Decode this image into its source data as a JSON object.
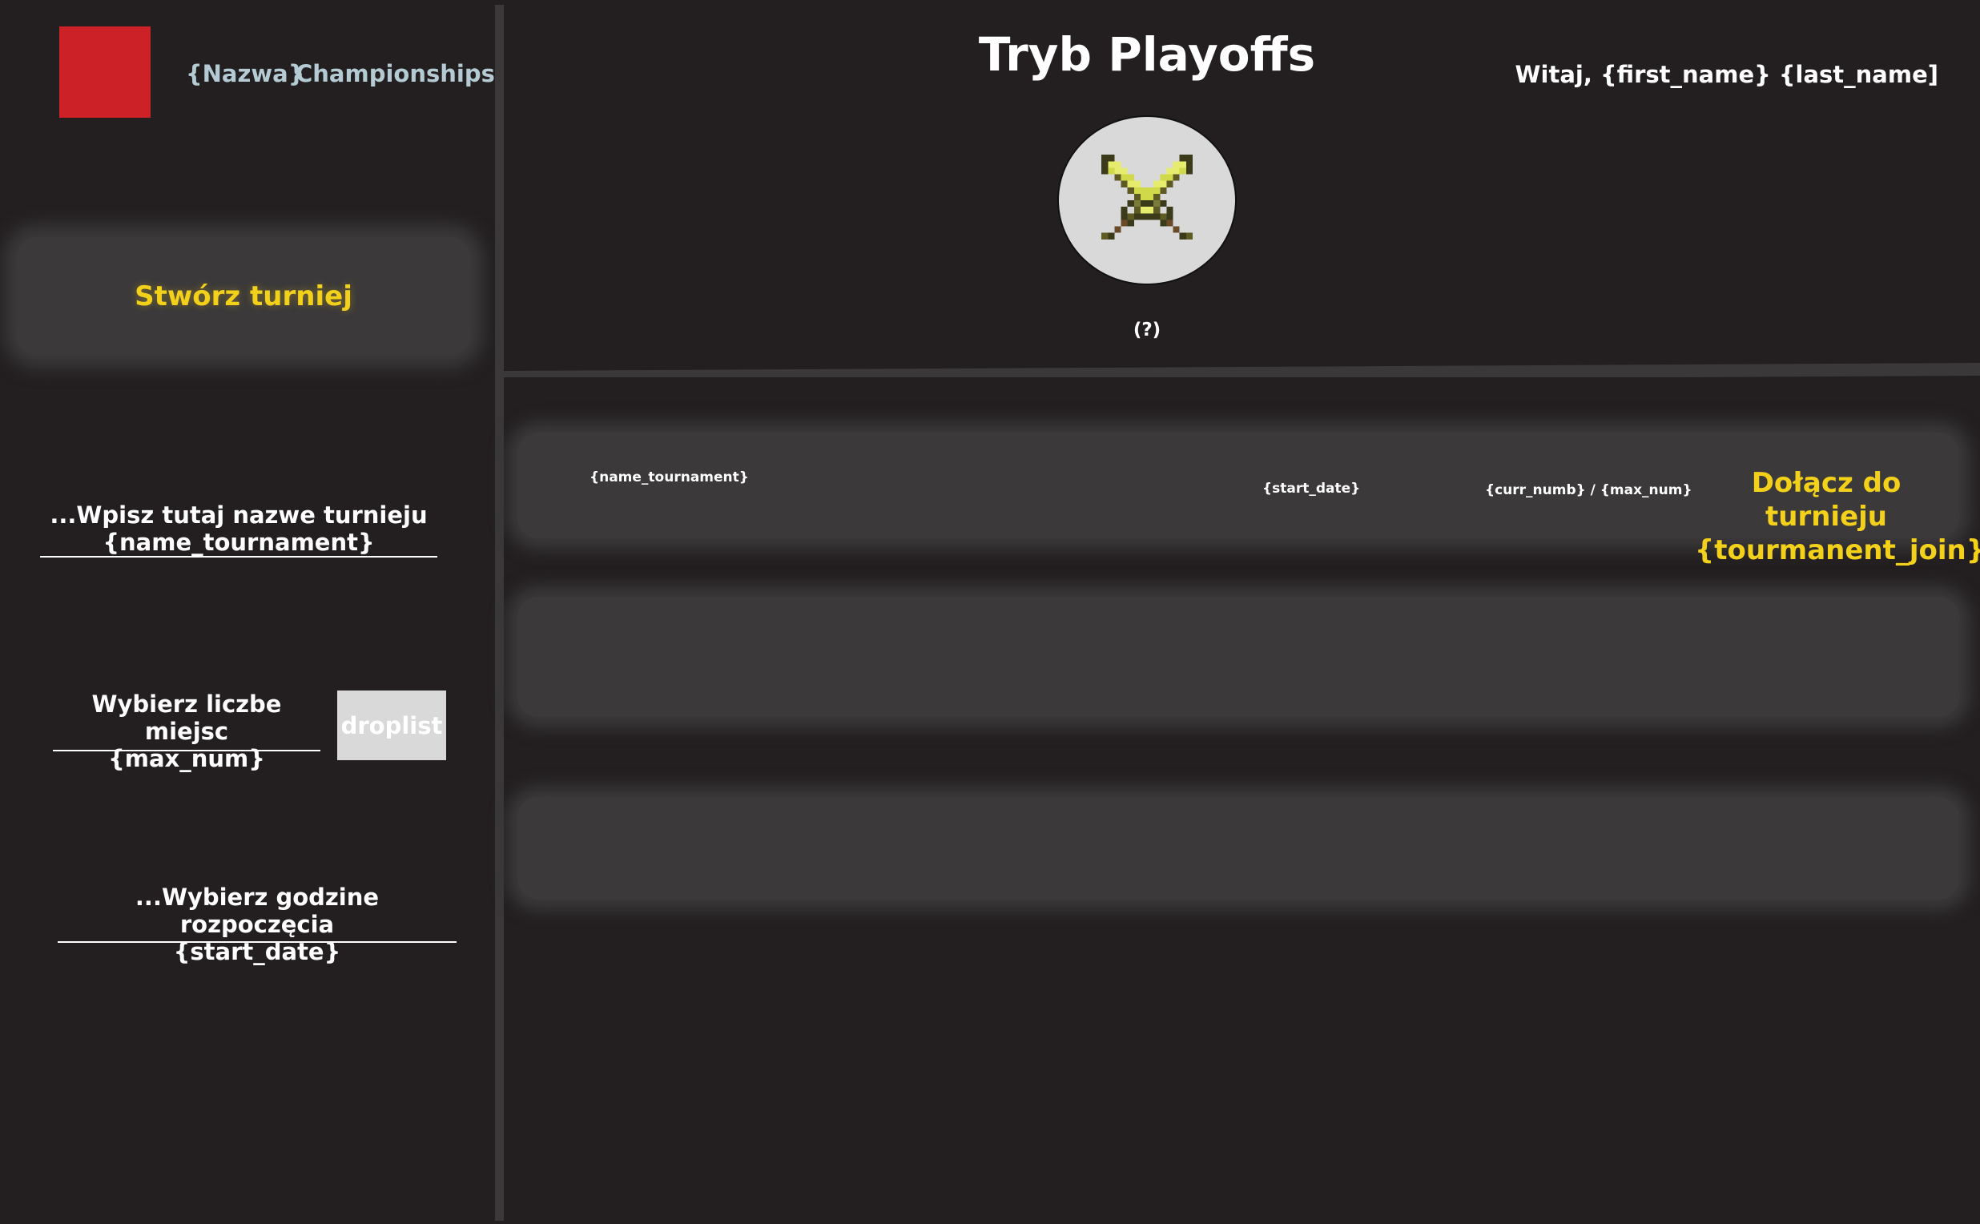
{
  "sidebar": {
    "brand_name": "{Nazwa}",
    "brand_suffix": "Championships",
    "create_button_label": "Stwórz turniej",
    "name_field": {
      "line1": "...Wpisz tutaj nazwe turnieju",
      "line2": "{name_tournament}"
    },
    "max_field": {
      "line1": "Wybierz liczbe miejsc",
      "line2": "{max_num}"
    },
    "droplist_label": "droplist",
    "date_field": {
      "line1": "...Wybierz godzine rozpoczęcia",
      "line2": "{start_date}"
    }
  },
  "header": {
    "title": "Tryb Playoffs",
    "greeting": "Witaj, {first_name} {last_name]",
    "mode_icon": "crossed-swords-icon",
    "help_label": "(?)"
  },
  "tournaments": [
    {
      "name": "{name_tournament}",
      "start_date": "{start_date}",
      "count": "{curr_numb} / {max_num}",
      "join_line1": "Dołącz do turnieju",
      "join_line2": "{tourmanent_join}"
    }
  ],
  "colors": {
    "background": "#231f20",
    "panel": "#3b393a",
    "accent_yellow": "#f3d11a",
    "logo_red": "#cc2227",
    "brand_text": "#b4cbd3"
  }
}
